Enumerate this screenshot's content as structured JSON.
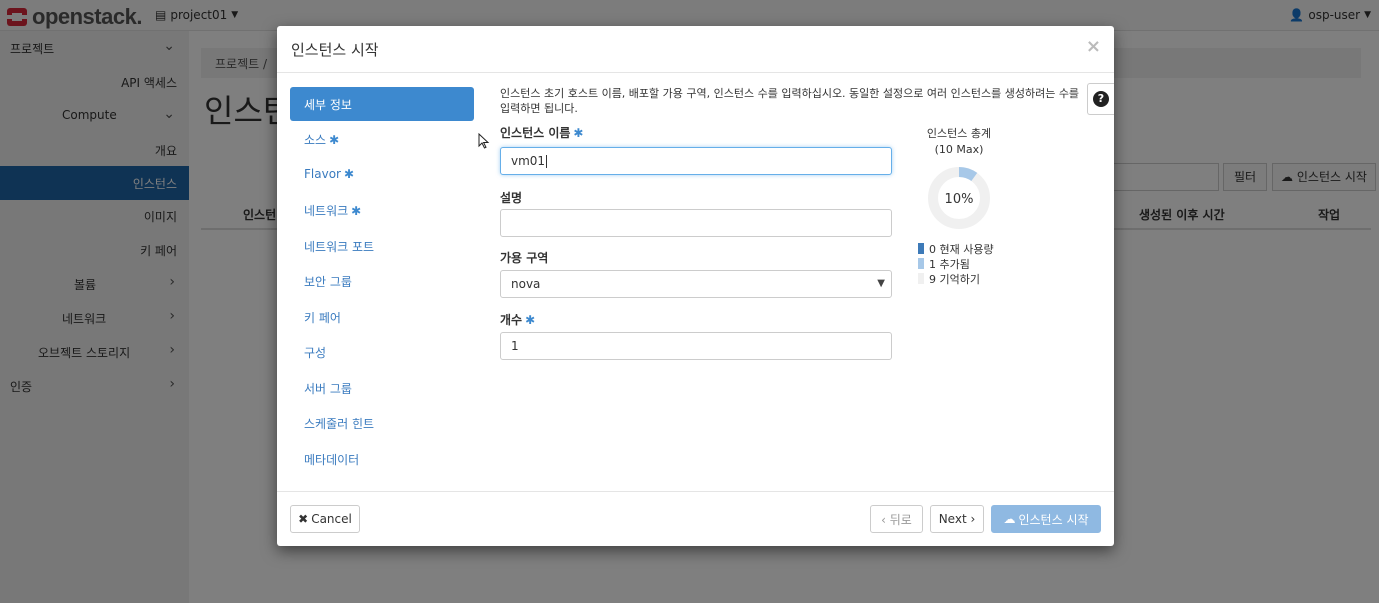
{
  "topbar": {
    "brand": "openstack.",
    "project": "project01",
    "user": "osp-user"
  },
  "sidebar": {
    "items": [
      {
        "label": "프로젝트"
      },
      {
        "label": "API 액세스"
      },
      {
        "label": "Compute"
      },
      {
        "label": "개요"
      },
      {
        "label": "인스턴스"
      },
      {
        "label": "이미지"
      },
      {
        "label": "키 페어"
      },
      {
        "label": "볼륨"
      },
      {
        "label": "네트워크"
      },
      {
        "label": "오브젝트 스토리지"
      },
      {
        "label": "인증"
      }
    ]
  },
  "main": {
    "breadcrumb": "프로젝트 /",
    "title": "인스턴",
    "filter_label": "필터",
    "launch_label": "인스턴스 시작",
    "columns": [
      "인스턴",
      "생성된 이후 시간",
      "작업"
    ]
  },
  "modal": {
    "title": "인스턴스 시작",
    "close": "×",
    "steps": [
      {
        "label": "세부 정보",
        "required": false
      },
      {
        "label": "소스",
        "required": true
      },
      {
        "label": "Flavor",
        "required": true
      },
      {
        "label": "네트워크",
        "required": true
      },
      {
        "label": "네트워크 포트",
        "required": false
      },
      {
        "label": "보안 그룹",
        "required": false
      },
      {
        "label": "키 페어",
        "required": false
      },
      {
        "label": "구성",
        "required": false
      },
      {
        "label": "서버 그룹",
        "required": false
      },
      {
        "label": "스케줄러 힌트",
        "required": false
      },
      {
        "label": "메타데이터",
        "required": false
      }
    ],
    "required_mark": "✱",
    "help": "인스턴스 초기 호스트 이름, 배포할 가용 구역, 인스턴스 수를 입력하십시오. 동일한 설정으로 여러 인스턴스를 생성하려는 수를 입력하면 됩니다.",
    "help_icon": "?",
    "fields": {
      "name_label": "인스턴스 이름",
      "name_value": "vm01",
      "desc_label": "설명",
      "desc_value": "",
      "az_label": "가용 구역",
      "az_value": "nova",
      "count_label": "개수",
      "count_value": "1"
    },
    "quota": {
      "title": "인스턴스 총계",
      "max": "(10 Max)",
      "percent_label": "10%",
      "percent": 10,
      "legend": [
        {
          "text": "0  현재 사용량",
          "color": "#3d7ab8"
        },
        {
          "text": "1  추가됨",
          "color": "#a7c8e8"
        },
        {
          "text": "9  기억하기",
          "color": "#f0f0f0"
        }
      ]
    },
    "footer": {
      "cancel": "Cancel",
      "back": "‹ 뒤로",
      "next": "Next ›",
      "launch": "인스턴스 시작"
    }
  }
}
